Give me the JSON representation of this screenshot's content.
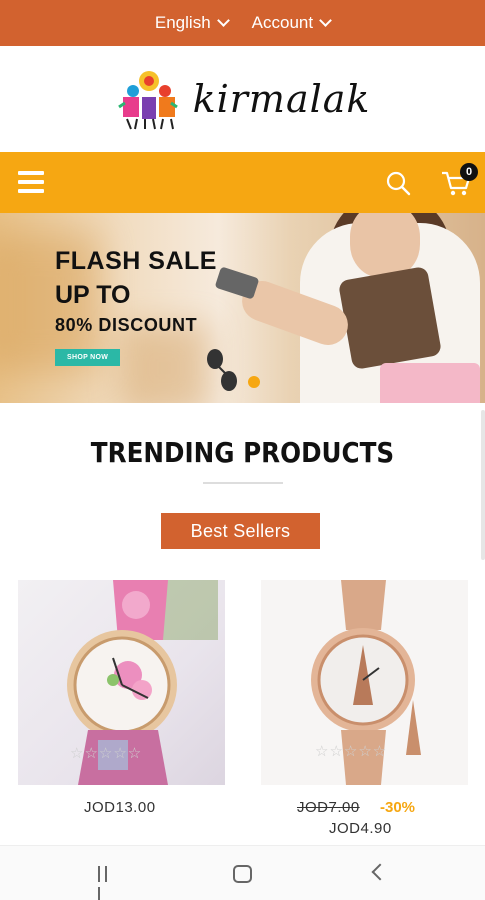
{
  "topbar": {
    "language": "English",
    "account": "Account"
  },
  "brand": {
    "name": "kirmalak"
  },
  "navbar": {
    "cart_count": "0"
  },
  "banner": {
    "line1": "FLASH SALE",
    "line2": "UP TO",
    "line3": "80% DISCOUNT",
    "cta": "SHOP NOW"
  },
  "section": {
    "title": "TRENDING PRODUCTS",
    "filter_button": "Best Sellers"
  },
  "products": [
    {
      "price": "JOD13.00",
      "rating": 0
    },
    {
      "old_price": "JOD7.00",
      "discount": "-30%",
      "price": "JOD4.90",
      "rating": 0
    }
  ],
  "colors": {
    "topbar": "#d2622f",
    "navbar": "#f6a712",
    "accent_button": "#d2622f",
    "discount": "#f6a712",
    "shop_now": "#2bb8a6"
  },
  "icons": [
    "chevron-down-icon",
    "hamburger-menu-icon",
    "search-icon",
    "cart-icon",
    "star-icon",
    "recent-apps-icon",
    "home-icon",
    "back-icon"
  ]
}
